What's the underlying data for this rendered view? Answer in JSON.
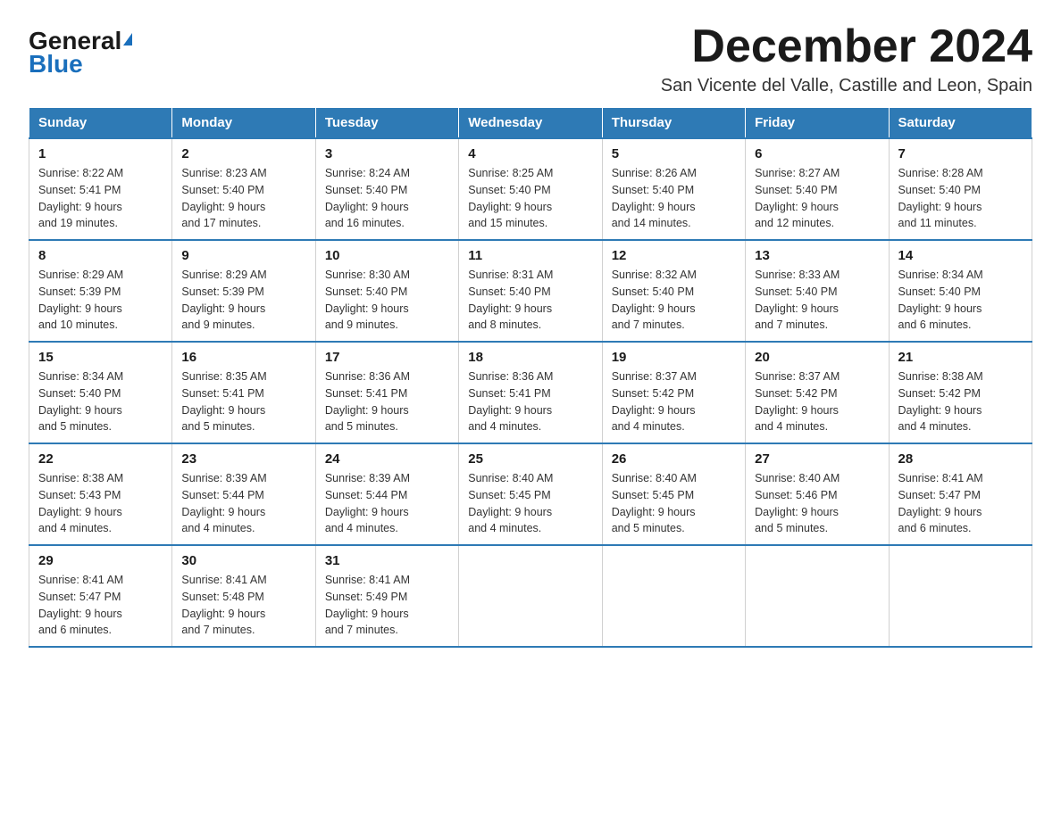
{
  "logo": {
    "general": "General",
    "triangle": "▲",
    "blue": "Blue"
  },
  "title": "December 2024",
  "location": "San Vicente del Valle, Castille and Leon, Spain",
  "weekdays": [
    "Sunday",
    "Monday",
    "Tuesday",
    "Wednesday",
    "Thursday",
    "Friday",
    "Saturday"
  ],
  "weeks": [
    [
      {
        "day": "1",
        "info": "Sunrise: 8:22 AM\nSunset: 5:41 PM\nDaylight: 9 hours\nand 19 minutes."
      },
      {
        "day": "2",
        "info": "Sunrise: 8:23 AM\nSunset: 5:40 PM\nDaylight: 9 hours\nand 17 minutes."
      },
      {
        "day": "3",
        "info": "Sunrise: 8:24 AM\nSunset: 5:40 PM\nDaylight: 9 hours\nand 16 minutes."
      },
      {
        "day": "4",
        "info": "Sunrise: 8:25 AM\nSunset: 5:40 PM\nDaylight: 9 hours\nand 15 minutes."
      },
      {
        "day": "5",
        "info": "Sunrise: 8:26 AM\nSunset: 5:40 PM\nDaylight: 9 hours\nand 14 minutes."
      },
      {
        "day": "6",
        "info": "Sunrise: 8:27 AM\nSunset: 5:40 PM\nDaylight: 9 hours\nand 12 minutes."
      },
      {
        "day": "7",
        "info": "Sunrise: 8:28 AM\nSunset: 5:40 PM\nDaylight: 9 hours\nand 11 minutes."
      }
    ],
    [
      {
        "day": "8",
        "info": "Sunrise: 8:29 AM\nSunset: 5:39 PM\nDaylight: 9 hours\nand 10 minutes."
      },
      {
        "day": "9",
        "info": "Sunrise: 8:29 AM\nSunset: 5:39 PM\nDaylight: 9 hours\nand 9 minutes."
      },
      {
        "day": "10",
        "info": "Sunrise: 8:30 AM\nSunset: 5:40 PM\nDaylight: 9 hours\nand 9 minutes."
      },
      {
        "day": "11",
        "info": "Sunrise: 8:31 AM\nSunset: 5:40 PM\nDaylight: 9 hours\nand 8 minutes."
      },
      {
        "day": "12",
        "info": "Sunrise: 8:32 AM\nSunset: 5:40 PM\nDaylight: 9 hours\nand 7 minutes."
      },
      {
        "day": "13",
        "info": "Sunrise: 8:33 AM\nSunset: 5:40 PM\nDaylight: 9 hours\nand 7 minutes."
      },
      {
        "day": "14",
        "info": "Sunrise: 8:34 AM\nSunset: 5:40 PM\nDaylight: 9 hours\nand 6 minutes."
      }
    ],
    [
      {
        "day": "15",
        "info": "Sunrise: 8:34 AM\nSunset: 5:40 PM\nDaylight: 9 hours\nand 5 minutes."
      },
      {
        "day": "16",
        "info": "Sunrise: 8:35 AM\nSunset: 5:41 PM\nDaylight: 9 hours\nand 5 minutes."
      },
      {
        "day": "17",
        "info": "Sunrise: 8:36 AM\nSunset: 5:41 PM\nDaylight: 9 hours\nand 5 minutes."
      },
      {
        "day": "18",
        "info": "Sunrise: 8:36 AM\nSunset: 5:41 PM\nDaylight: 9 hours\nand 4 minutes."
      },
      {
        "day": "19",
        "info": "Sunrise: 8:37 AM\nSunset: 5:42 PM\nDaylight: 9 hours\nand 4 minutes."
      },
      {
        "day": "20",
        "info": "Sunrise: 8:37 AM\nSunset: 5:42 PM\nDaylight: 9 hours\nand 4 minutes."
      },
      {
        "day": "21",
        "info": "Sunrise: 8:38 AM\nSunset: 5:42 PM\nDaylight: 9 hours\nand 4 minutes."
      }
    ],
    [
      {
        "day": "22",
        "info": "Sunrise: 8:38 AM\nSunset: 5:43 PM\nDaylight: 9 hours\nand 4 minutes."
      },
      {
        "day": "23",
        "info": "Sunrise: 8:39 AM\nSunset: 5:44 PM\nDaylight: 9 hours\nand 4 minutes."
      },
      {
        "day": "24",
        "info": "Sunrise: 8:39 AM\nSunset: 5:44 PM\nDaylight: 9 hours\nand 4 minutes."
      },
      {
        "day": "25",
        "info": "Sunrise: 8:40 AM\nSunset: 5:45 PM\nDaylight: 9 hours\nand 4 minutes."
      },
      {
        "day": "26",
        "info": "Sunrise: 8:40 AM\nSunset: 5:45 PM\nDaylight: 9 hours\nand 5 minutes."
      },
      {
        "day": "27",
        "info": "Sunrise: 8:40 AM\nSunset: 5:46 PM\nDaylight: 9 hours\nand 5 minutes."
      },
      {
        "day": "28",
        "info": "Sunrise: 8:41 AM\nSunset: 5:47 PM\nDaylight: 9 hours\nand 6 minutes."
      }
    ],
    [
      {
        "day": "29",
        "info": "Sunrise: 8:41 AM\nSunset: 5:47 PM\nDaylight: 9 hours\nand 6 minutes."
      },
      {
        "day": "30",
        "info": "Sunrise: 8:41 AM\nSunset: 5:48 PM\nDaylight: 9 hours\nand 7 minutes."
      },
      {
        "day": "31",
        "info": "Sunrise: 8:41 AM\nSunset: 5:49 PM\nDaylight: 9 hours\nand 7 minutes."
      },
      null,
      null,
      null,
      null
    ]
  ]
}
